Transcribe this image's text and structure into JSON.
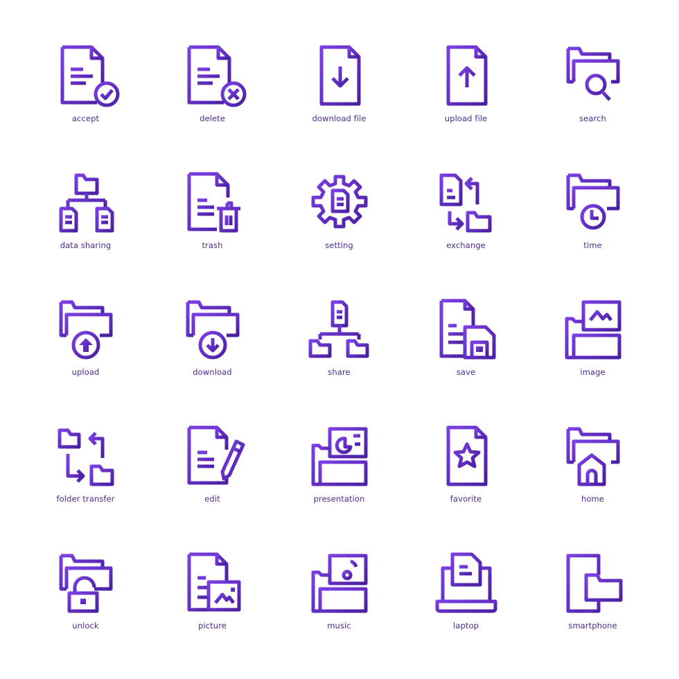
{
  "colors": {
    "gradient_start": "#7b3fe4",
    "gradient_end": "#4a1fa0",
    "label": "#4b2a8c",
    "background": "#ffffff"
  },
  "icons": [
    {
      "label": "accept",
      "icon": "file-check-icon"
    },
    {
      "label": "delete",
      "icon": "file-delete-icon"
    },
    {
      "label": "download file",
      "icon": "file-download-icon"
    },
    {
      "label": "upload file",
      "icon": "file-upload-icon"
    },
    {
      "label": "search",
      "icon": "folder-search-icon"
    },
    {
      "label": "data sharing",
      "icon": "data-sharing-icon"
    },
    {
      "label": "trash",
      "icon": "file-trash-icon"
    },
    {
      "label": "setting",
      "icon": "file-setting-icon"
    },
    {
      "label": "exchange",
      "icon": "file-exchange-icon"
    },
    {
      "label": "time",
      "icon": "folder-time-icon"
    },
    {
      "label": "upload",
      "icon": "folder-upload-icon"
    },
    {
      "label": "download",
      "icon": "folder-download-icon"
    },
    {
      "label": "share",
      "icon": "file-share-icon"
    },
    {
      "label": "save",
      "icon": "file-save-icon"
    },
    {
      "label": "image",
      "icon": "folder-image-icon"
    },
    {
      "label": "folder transfer",
      "icon": "folder-transfer-icon"
    },
    {
      "label": "edit",
      "icon": "file-edit-icon"
    },
    {
      "label": "presentation",
      "icon": "folder-presentation-icon"
    },
    {
      "label": "favorite",
      "icon": "file-favorite-icon"
    },
    {
      "label": "home",
      "icon": "folder-home-icon"
    },
    {
      "label": "unlock",
      "icon": "folder-unlock-icon"
    },
    {
      "label": "picture",
      "icon": "file-picture-icon"
    },
    {
      "label": "music",
      "icon": "folder-music-icon"
    },
    {
      "label": "laptop",
      "icon": "laptop-file-icon"
    },
    {
      "label": "smartphone",
      "icon": "smartphone-folder-icon"
    }
  ]
}
